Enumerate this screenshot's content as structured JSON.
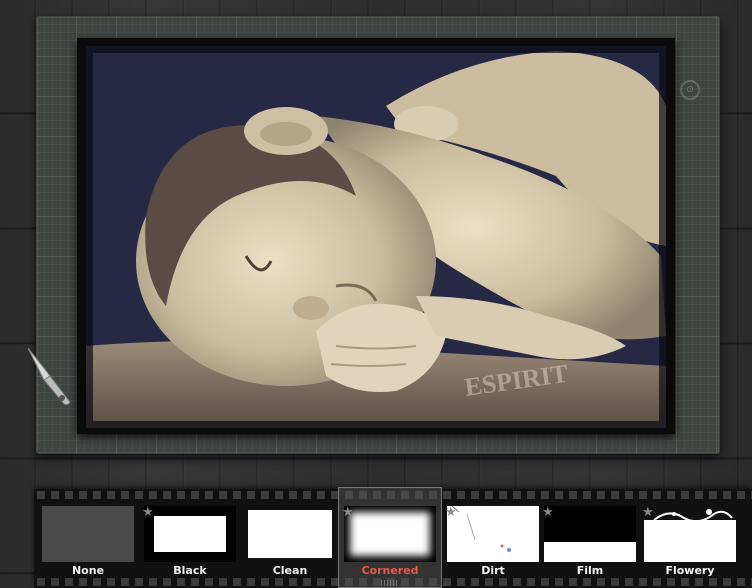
{
  "frames": [
    {
      "label": "None",
      "favorite": false,
      "selected": false
    },
    {
      "label": "Black",
      "favorite": true,
      "selected": false
    },
    {
      "label": "Clean",
      "favorite": false,
      "selected": false
    },
    {
      "label": "Cornered",
      "favorite": true,
      "selected": true
    },
    {
      "label": "Dirt",
      "favorite": true,
      "selected": false
    },
    {
      "label": "Film",
      "favorite": true,
      "selected": false
    },
    {
      "label": "Flowery",
      "favorite": true,
      "selected": false
    }
  ],
  "icons": {
    "star": "star-icon",
    "craft_knife": "craft-knife-icon",
    "mat_logo": "mat-logo-icon"
  },
  "colors": {
    "selected_label": "#e55a4a",
    "label": "#f2f2f2",
    "mat": "#3f4441"
  }
}
